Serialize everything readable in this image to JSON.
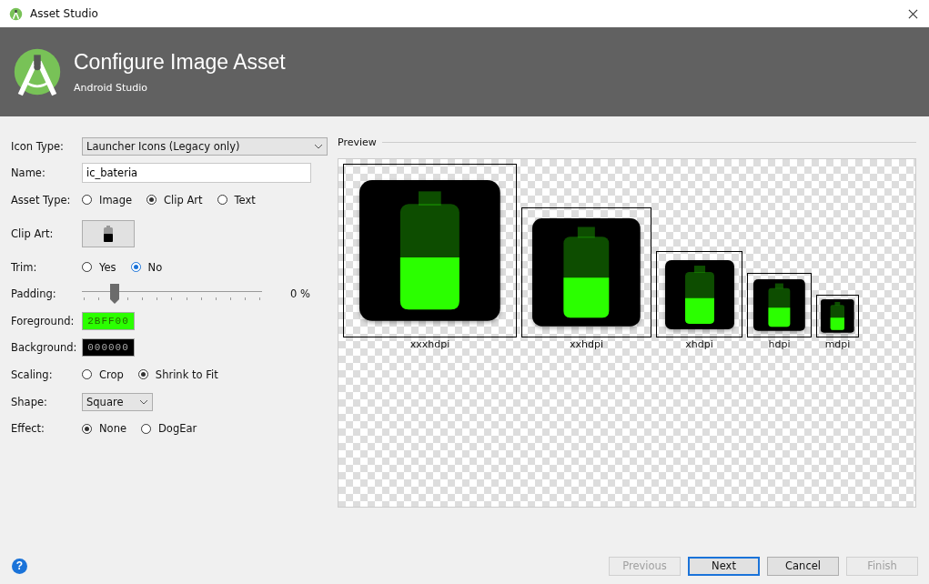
{
  "window": {
    "title": "Asset Studio"
  },
  "header": {
    "title": "Configure Image Asset",
    "subtitle": "Android Studio"
  },
  "rows": [
    {
      "kind": "dropdown",
      "label": "Icon Type:",
      "value": "Launcher Icons (Legacy only)"
    },
    {
      "kind": "text",
      "label": "Name:",
      "value": "ic_bateria"
    },
    {
      "kind": "radio",
      "label": "Asset Type:",
      "options": [
        {
          "label": "Image",
          "selected": false
        },
        {
          "label": "Clip Art",
          "selected": true
        },
        {
          "label": "Text",
          "selected": false
        }
      ]
    },
    {
      "kind": "clipart",
      "label": "Clip Art:"
    },
    {
      "kind": "radio",
      "label": "Trim:",
      "options": [
        {
          "label": "Yes",
          "selected": false
        },
        {
          "label": "No",
          "selected": true
        }
      ]
    },
    {
      "kind": "slider",
      "label": "Padding:",
      "level": 0.18,
      "reading": "0 %"
    },
    {
      "kind": "color",
      "label": "Foreground:",
      "value": "2BFF00",
      "color": "#2bff00"
    },
    {
      "kind": "color",
      "label": "Background:",
      "value": "000000",
      "color": "#000000"
    },
    {
      "kind": "radio",
      "label": "Scaling:",
      "options": [
        {
          "label": "Crop",
          "selected": false
        },
        {
          "label": "Shrink to Fit",
          "selected": true
        }
      ]
    },
    {
      "kind": "smalldropdown",
      "label": "Shape:",
      "value": "Square"
    },
    {
      "kind": "radio",
      "label": "Effect:",
      "options": [
        {
          "label": "None",
          "selected": true
        },
        {
          "label": "DogEar",
          "selected": false
        }
      ]
    }
  ],
  "preview": {
    "title": "Preview",
    "items": [
      {
        "label": "xxxhdpi"
      },
      {
        "label": "xxhdpi"
      },
      {
        "label": "xhdpi"
      },
      {
        "label": "hdpi"
      },
      {
        "label": "mdpi"
      }
    ]
  },
  "help": {
    "symbol": "?"
  },
  "buttons": [
    {
      "label": "Previous",
      "disabled": true,
      "default": false
    },
    {
      "label": "Next",
      "disabled": false,
      "default": true
    },
    {
      "label": "Cancel",
      "disabled": false,
      "default": false
    },
    {
      "label": "Finish",
      "disabled": true,
      "default": false
    }
  ]
}
